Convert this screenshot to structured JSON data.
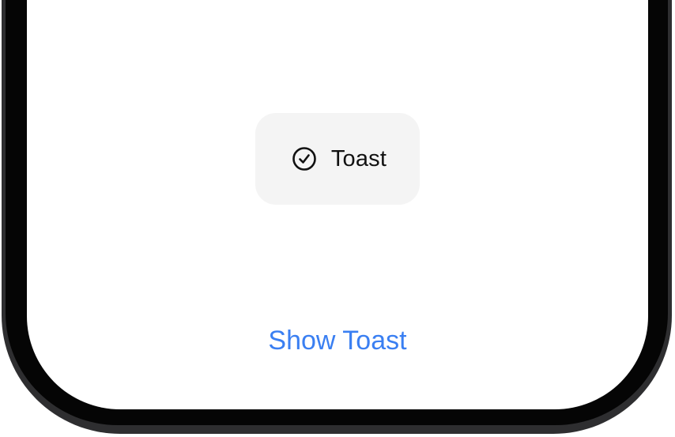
{
  "toast": {
    "icon": "checkmark-circle-icon",
    "label": "Toast"
  },
  "main": {
    "show_toast_label": "Show Toast"
  },
  "colors": {
    "accent": "#3a7ff2",
    "toast_background": "#f4f4f4",
    "bezel": "#050505",
    "frame": "#2e2e30"
  }
}
